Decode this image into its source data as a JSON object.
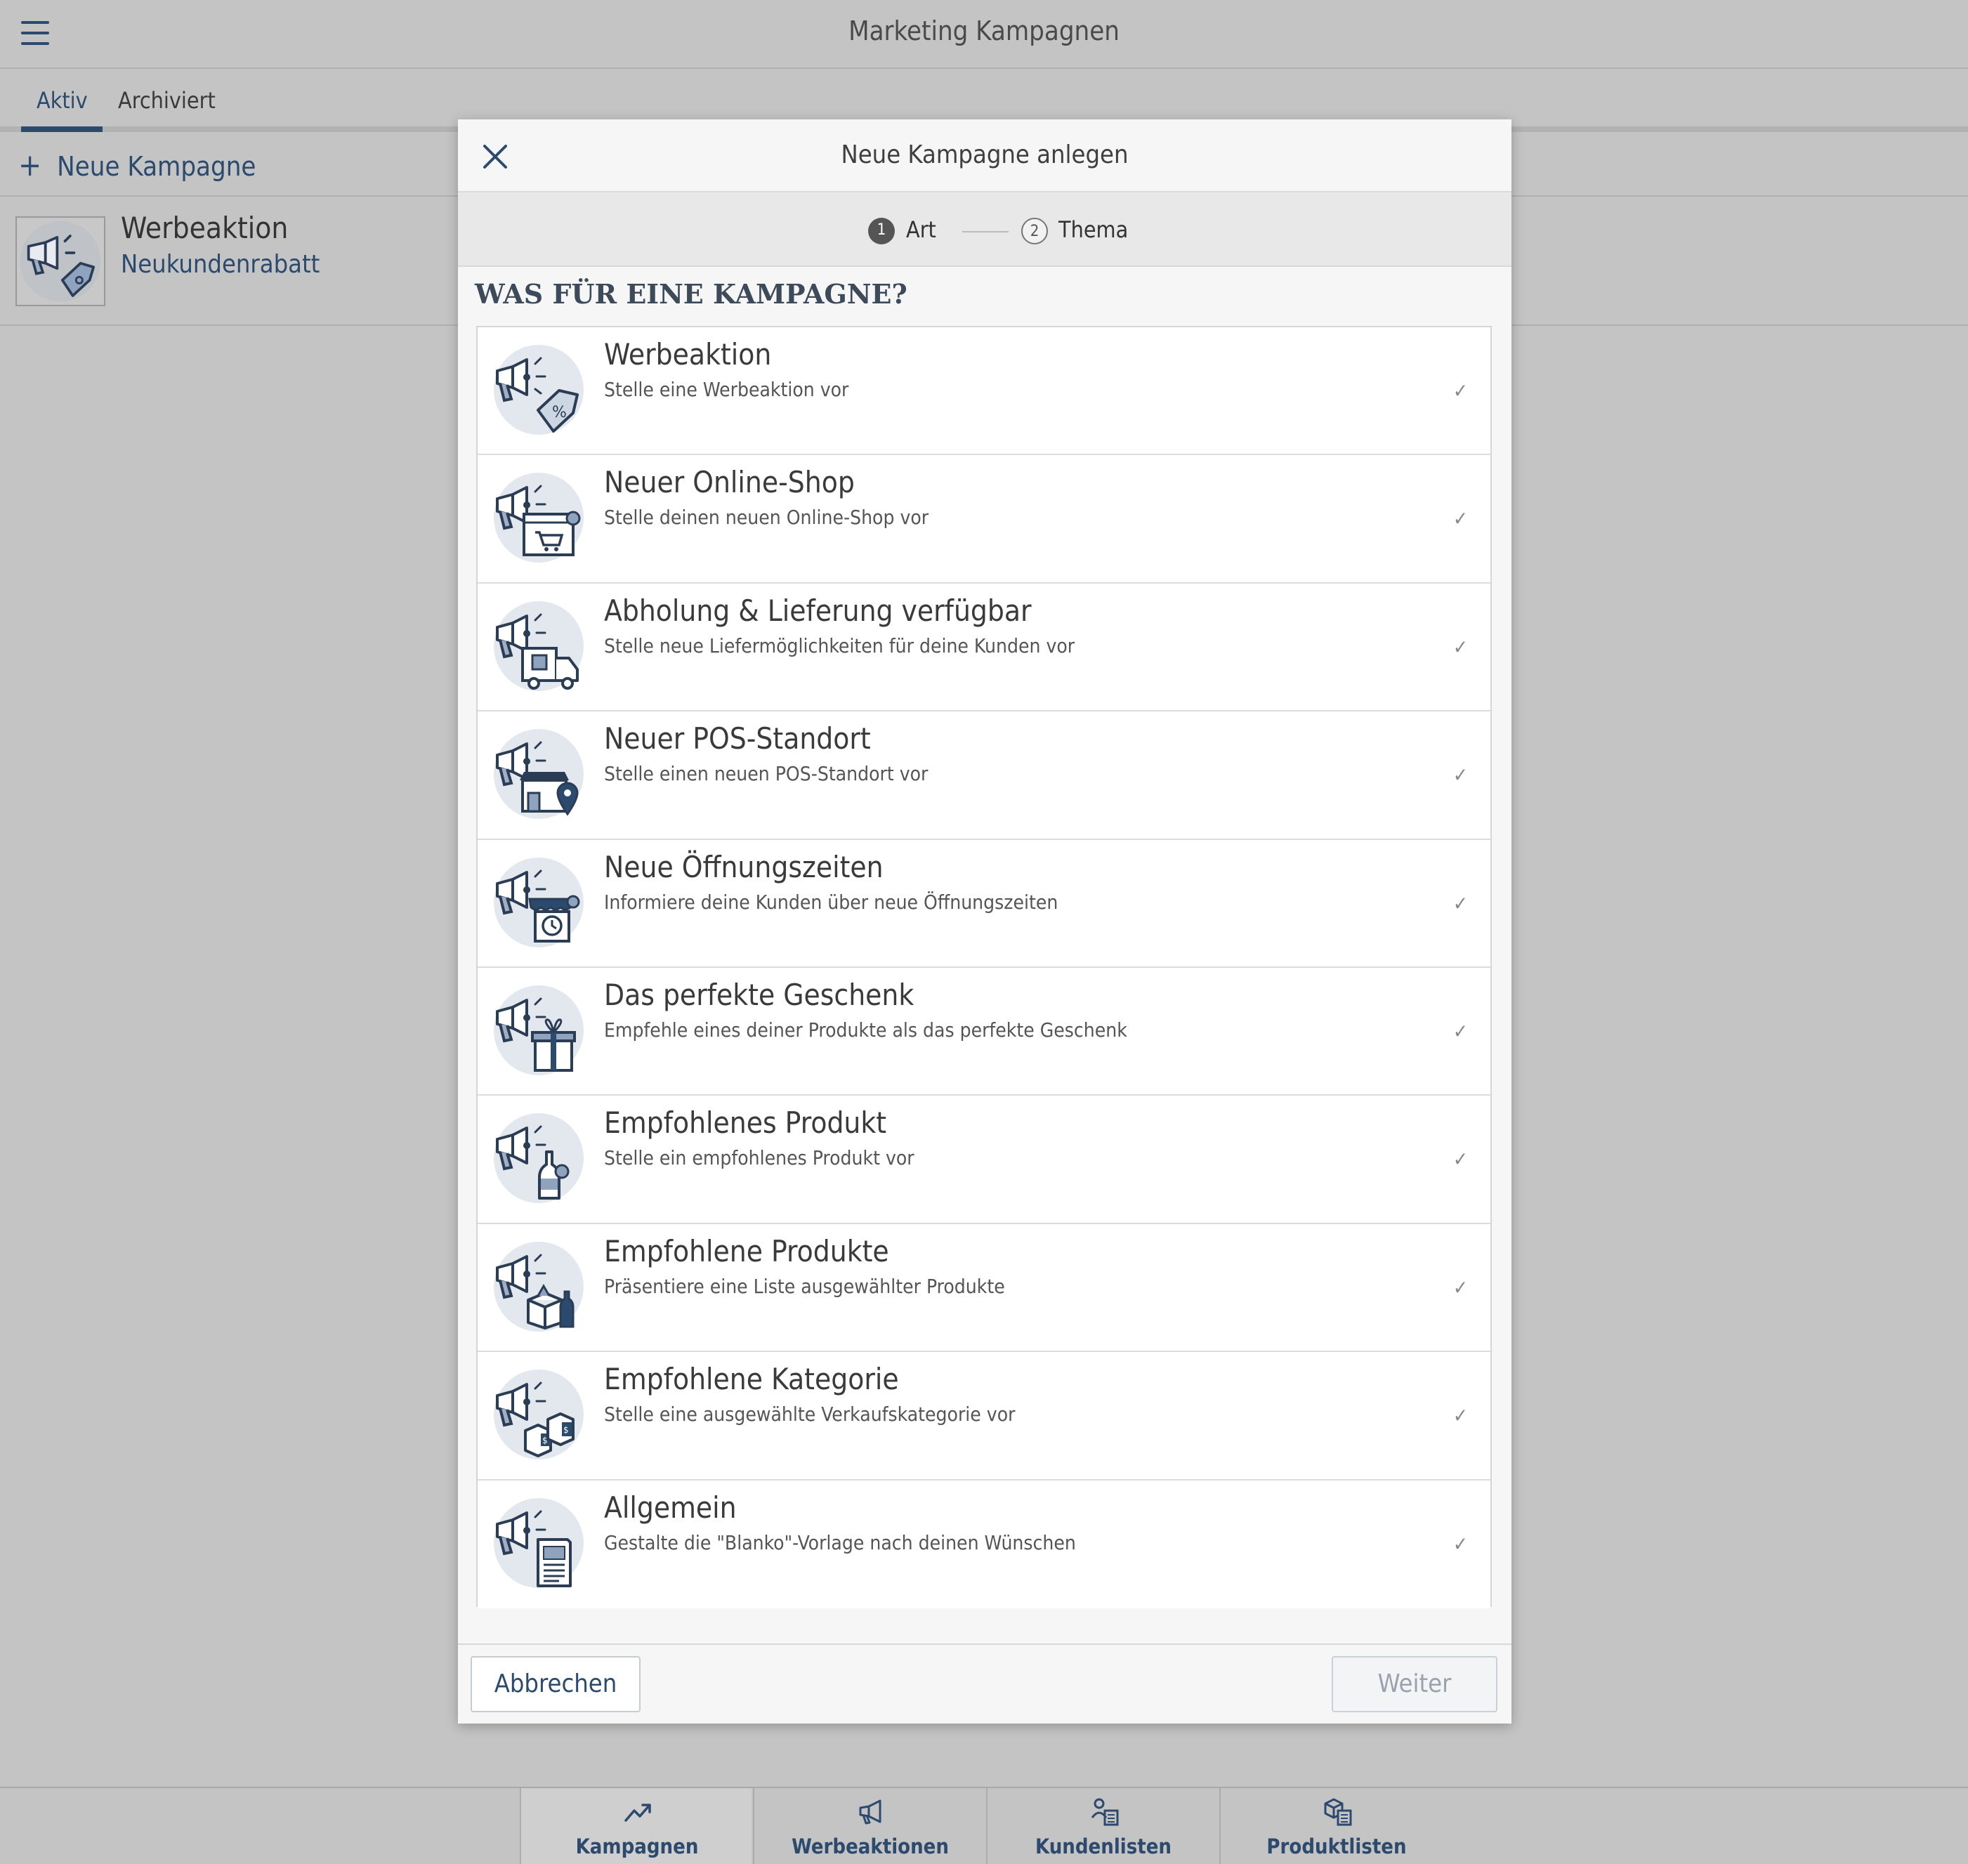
{
  "app": {
    "title": "Marketing Kampagnen",
    "menu_icon": "hamburger-icon"
  },
  "tabs": [
    {
      "label": "Aktiv",
      "active": true
    },
    {
      "label": "Archiviert",
      "active": false
    }
  ],
  "new_campaign": {
    "plus": "+",
    "label": "Neue Kampagne"
  },
  "campaigns": [
    {
      "title": "Werbeaktion",
      "subtitle": "Neukundenrabatt"
    }
  ],
  "bottom_nav": [
    {
      "label": "Kampagnen",
      "icon": "trend-icon",
      "active": true
    },
    {
      "label": "Werbeaktionen",
      "icon": "megaphone-icon",
      "active": false
    },
    {
      "label": "Kundenlisten",
      "icon": "customer-list-icon",
      "active": false
    },
    {
      "label": "Produktlisten",
      "icon": "product-list-icon",
      "active": false
    }
  ],
  "modal": {
    "title": "Neue Kampagne anlegen",
    "steps": [
      {
        "num": "1",
        "label": "Art",
        "active": true
      },
      {
        "num": "2",
        "label": "Thema",
        "active": false
      }
    ],
    "section_title": "WAS FÜR EINE KAMPAGNE?",
    "options": [
      {
        "title": "Werbeaktion",
        "desc": "Stelle eine Werbeaktion vor",
        "icon": "promo-tag-icon"
      },
      {
        "title": "Neuer Online-Shop",
        "desc": "Stelle deinen neuen Online-Shop vor",
        "icon": "online-shop-icon"
      },
      {
        "title": "Abholung & Lieferung verfügbar",
        "desc": "Stelle neue Liefermöglichkeiten für deine Kunden vor",
        "icon": "delivery-truck-icon"
      },
      {
        "title": "Neuer POS-Standort",
        "desc": "Stelle einen neuen POS-Standort vor",
        "icon": "store-location-icon"
      },
      {
        "title": "Neue Öffnungszeiten",
        "desc": "Informiere deine Kunden über neue Öffnungszeiten",
        "icon": "opening-hours-icon"
      },
      {
        "title": "Das perfekte Geschenk",
        "desc": "Empfehle eines deiner Produkte als das perfekte Geschenk",
        "icon": "gift-icon"
      },
      {
        "title": "Empfohlenes Produkt",
        "desc": "Stelle ein empfohlenes Produkt vor",
        "icon": "bottle-icon"
      },
      {
        "title": "Empfohlene Produkte",
        "desc": "Präsentiere eine Liste ausgewählter Produkte",
        "icon": "product-box-icon"
      },
      {
        "title": "Empfohlene Kategorie",
        "desc": "Stelle eine ausgewählte Verkaufskategorie vor",
        "icon": "category-boxes-icon"
      },
      {
        "title": "Allgemein",
        "desc": "Gestalte die \"Blanko\"-Vorlage nach deinen Wünschen",
        "icon": "document-icon"
      }
    ],
    "check_glyph": "✓",
    "cancel_label": "Abbrechen",
    "next_label": "Weiter"
  },
  "colors": {
    "accent": "#2b4a6e",
    "overlay_bg": "#c4c4c4",
    "modal_bg": "#f6f6f6",
    "icon_circle": "#e3e8ef"
  }
}
